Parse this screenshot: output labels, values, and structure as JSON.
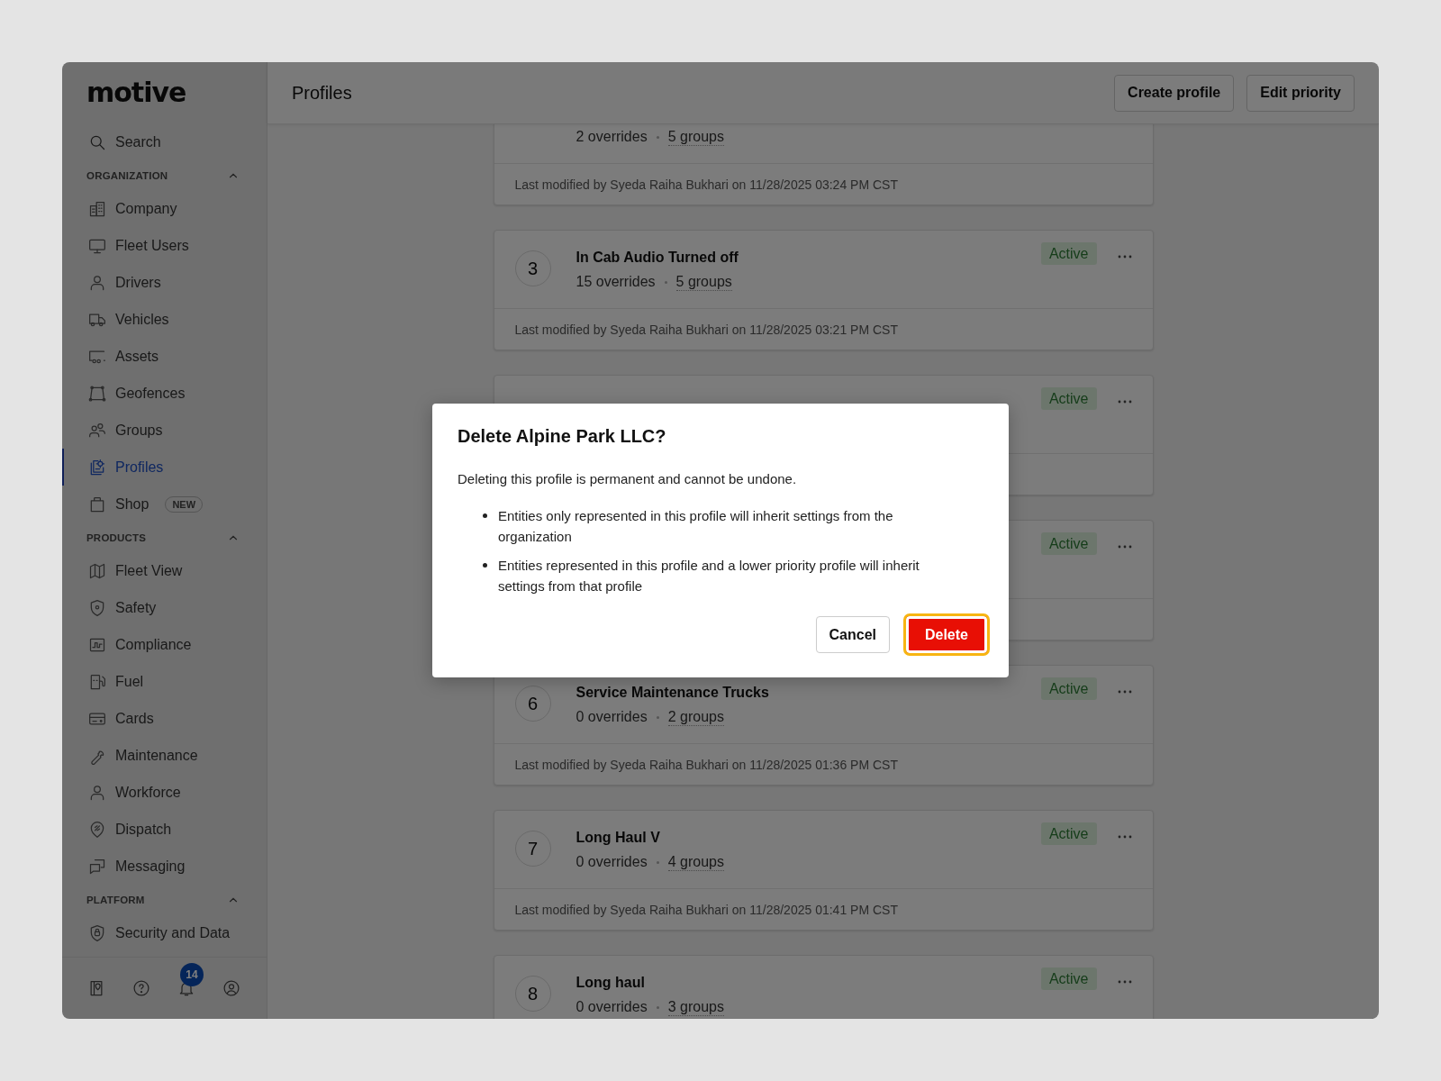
{
  "sidebar": {
    "logo": "motive",
    "search": {
      "placeholder": "Search"
    },
    "sections": [
      {
        "title": "ORGANIZATION",
        "expanded": true,
        "items": [
          {
            "label": "Company",
            "selected": false
          },
          {
            "label": "Fleet Users",
            "selected": false
          },
          {
            "label": "Drivers",
            "selected": false
          },
          {
            "label": "Vehicles",
            "selected": false
          },
          {
            "label": "Assets",
            "selected": false
          },
          {
            "label": "Geofences",
            "selected": false
          },
          {
            "label": "Groups",
            "selected": false
          },
          {
            "label": "Profiles",
            "selected": true
          },
          {
            "label": "Shop",
            "selected": false,
            "badge": "NEW"
          }
        ]
      },
      {
        "title": "PRODUCTS",
        "expanded": true,
        "items": [
          {
            "label": "Fleet View",
            "selected": false
          },
          {
            "label": "Safety",
            "selected": false
          },
          {
            "label": "Compliance",
            "selected": false
          },
          {
            "label": "Fuel",
            "selected": false
          },
          {
            "label": "Cards",
            "selected": false
          },
          {
            "label": "Maintenance",
            "selected": false
          },
          {
            "label": "Workforce",
            "selected": false
          },
          {
            "label": "Dispatch",
            "selected": false
          },
          {
            "label": "Messaging",
            "selected": false
          }
        ]
      },
      {
        "title": "PLATFORM",
        "expanded": true,
        "items": [
          {
            "label": "Security and Data",
            "selected": false
          }
        ]
      }
    ],
    "footer": {
      "notification_count": "14"
    }
  },
  "header": {
    "title": "Profiles",
    "buttons": [
      "Create profile",
      "Edit priority"
    ]
  },
  "cards": [
    {
      "overrides": "2 overrides",
      "groups": "5 groups",
      "modified": "Last modified by Syeda Raiha Bukhari on 11/28/2025 03:24 PM CST"
    },
    {
      "number": "3",
      "title": "In Cab Audio Turned off",
      "overrides": "15 overrides",
      "groups": "5 groups",
      "status": "Active",
      "modified": "Last modified by Syeda Raiha Bukhari on 11/28/2025 03:21 PM CST"
    },
    {
      "status": "Active"
    },
    {
      "status": "Active"
    },
    {
      "number": "6",
      "title": "Service Maintenance Trucks",
      "overrides": "0 overrides",
      "groups": "2 groups",
      "status": "Active",
      "modified": "Last modified by Syeda Raiha Bukhari on 11/28/2025 01:36 PM CST"
    },
    {
      "number": "7",
      "title": "Long Haul V",
      "overrides": "0 overrides",
      "groups": "4 groups",
      "status": "Active",
      "modified": "Last modified by Syeda Raiha Bukhari on 11/28/2025 01:41 PM CST"
    },
    {
      "number": "8",
      "title": "Long haul",
      "overrides": "0 overrides",
      "groups": "3 groups",
      "status": "Active"
    }
  ],
  "dialog": {
    "title": "Delete Alpine Park LLC?",
    "message": "Deleting this profile is permanent and cannot be undone.",
    "bullets": [
      "Entities only represented in this profile will inherit settings from the organization",
      "Entities represented in this profile and a lower priority profile will inherit settings from that profile"
    ],
    "buttons": [
      {
        "label": "Cancel",
        "kind": "secondary",
        "focused": false
      },
      {
        "label": "Delete",
        "kind": "danger",
        "focused": true
      }
    ]
  }
}
